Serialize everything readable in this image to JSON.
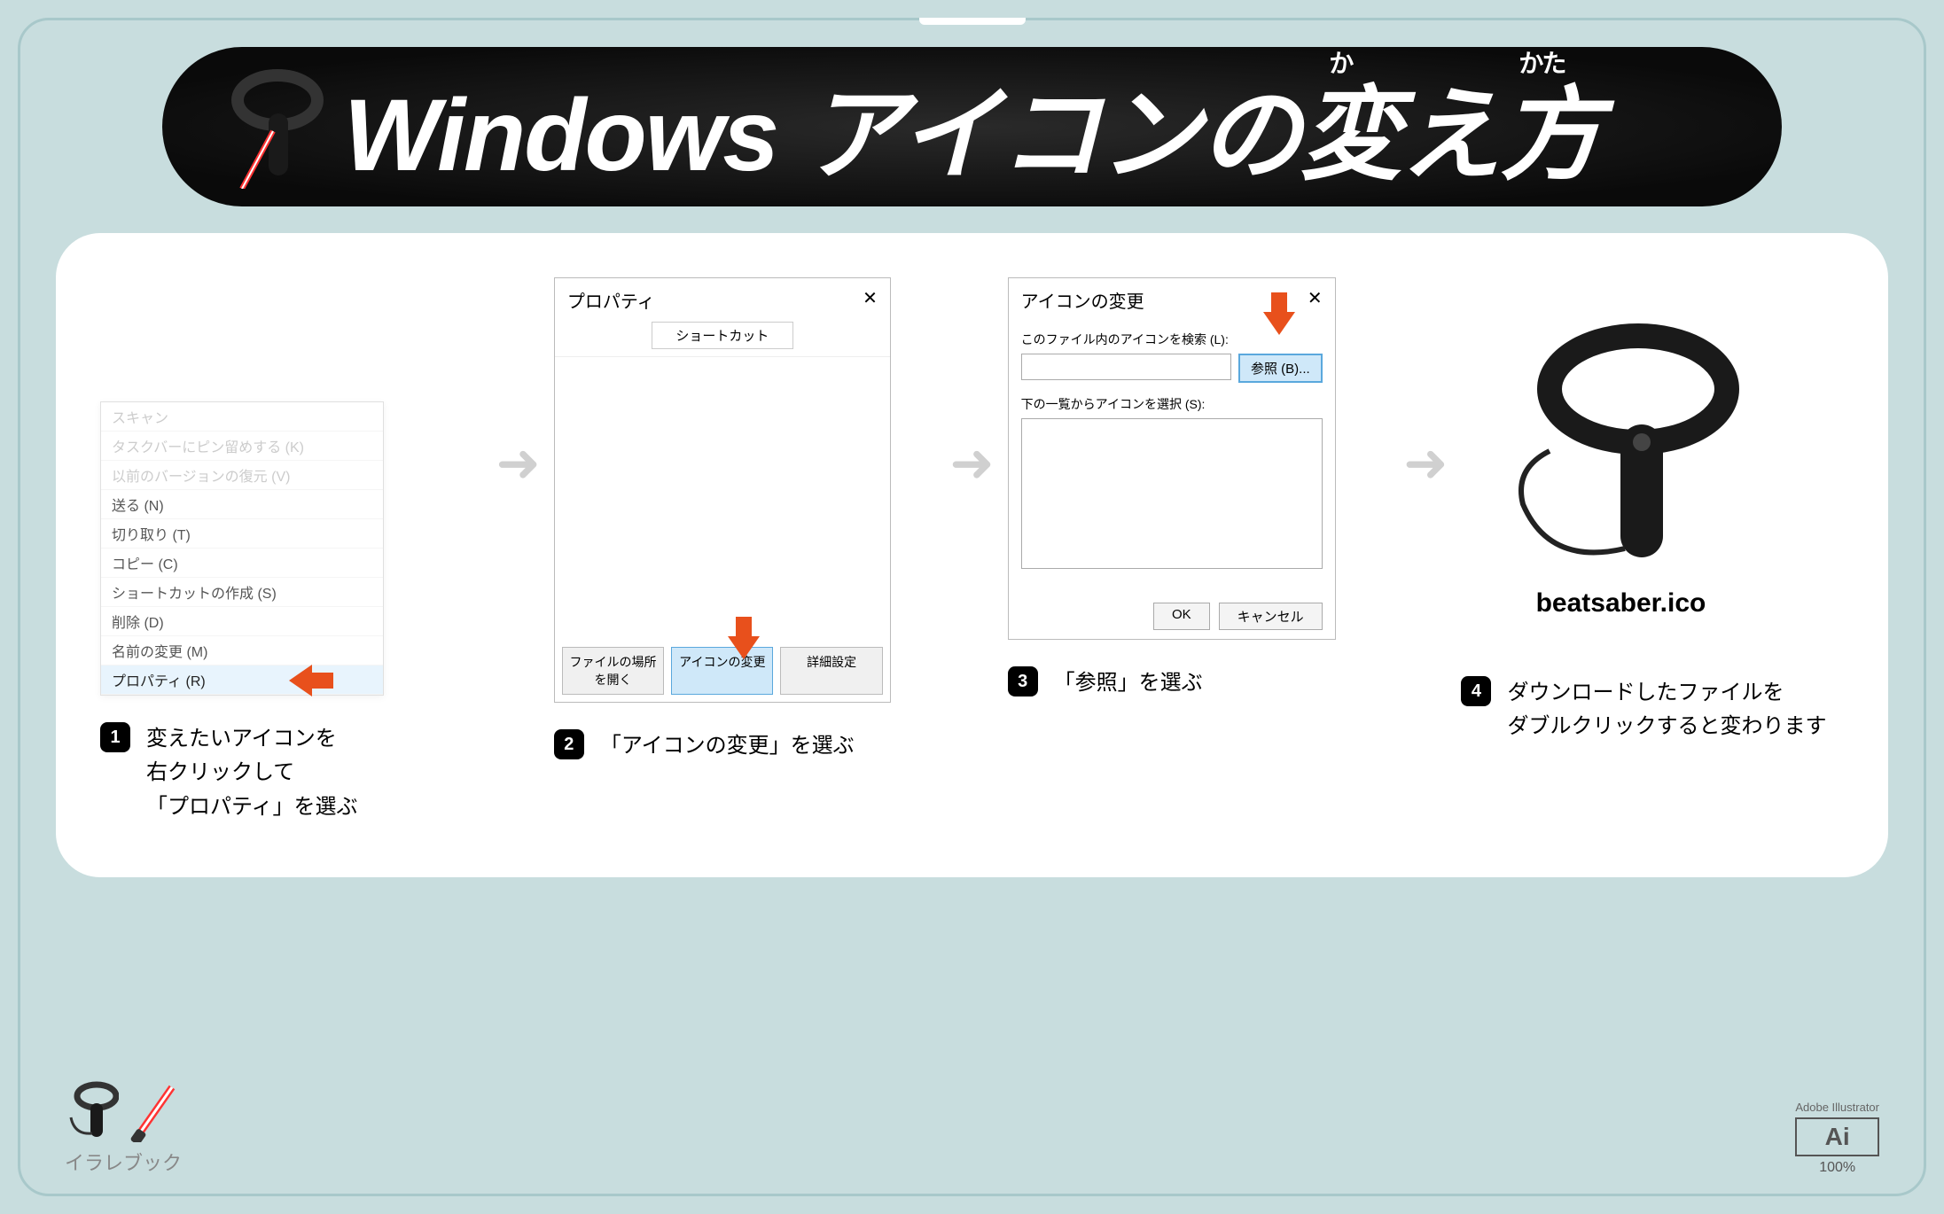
{
  "header": {
    "title": "Windows アイコンの変え方",
    "ruby_ka": "か",
    "ruby_kata": "かた"
  },
  "step1": {
    "menu": {
      "items_faded": [
        "スキャン",
        "タスクバーにピン留めする (K)",
        "以前のバージョンの復元 (V)"
      ],
      "items": [
        "送る (N)",
        "切り取り (T)",
        "コピー (C)",
        "ショートカットの作成 (S)",
        "削除 (D)",
        "名前の変更 (M)"
      ],
      "highlight": "プロパティ (R)"
    },
    "num": "1",
    "text": "変えたいアイコンを\n右クリックして\n「プロパティ」を選ぶ"
  },
  "step2": {
    "window_title": "プロパティ",
    "close": "✕",
    "tab": "ショートカット",
    "buttons": {
      "open": "ファイルの場所を開く",
      "change": "アイコンの変更",
      "advanced": "詳細設定"
    },
    "num": "2",
    "text": "「アイコンの変更」を選ぶ"
  },
  "step3": {
    "window_title": "アイコンの変更",
    "close": "✕",
    "label1": "このファイル内のアイコンを検索 (L):",
    "browse": "参照 (B)...",
    "label2": "下の一覧からアイコンを選択 (S):",
    "ok": "OK",
    "cancel": "キャンセル",
    "num": "3",
    "text": "「参照」を選ぶ"
  },
  "step4": {
    "filename": "beatsaber.ico",
    "num": "4",
    "text": "ダウンロードしたファイルを\nダブルクリックすると変わります"
  },
  "footer": {
    "label": "イラレブック",
    "ai_sub": "Adobe Illustrator",
    "ai": "Ai",
    "pct": "100%"
  }
}
